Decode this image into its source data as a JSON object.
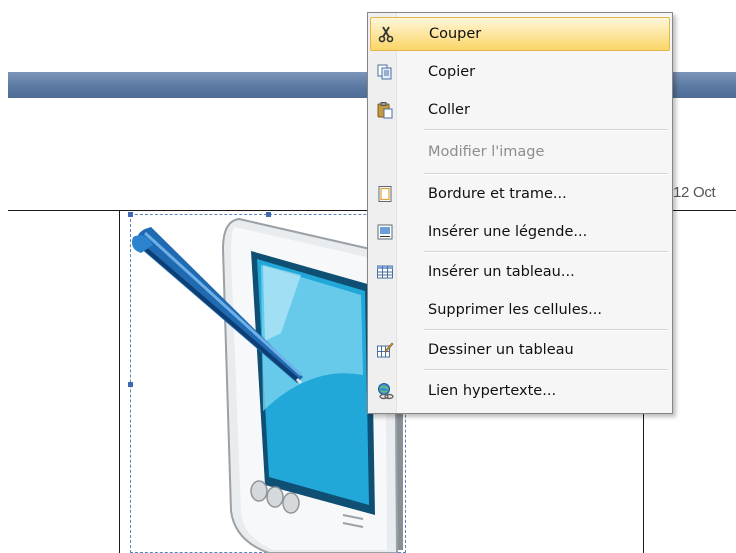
{
  "document": {
    "date_fragment": "12 Oct"
  },
  "context_menu": {
    "items": [
      {
        "label": "Couper",
        "icon": "scissors-icon",
        "highlighted": true,
        "enabled": true
      },
      {
        "label": "Copier",
        "icon": "copy-icon",
        "enabled": true
      },
      {
        "label": "Coller",
        "icon": "paste-icon",
        "enabled": true
      },
      {
        "label": "Modifier l'image",
        "icon": "",
        "enabled": false
      },
      {
        "label": "Bordure et trame...",
        "icon": "page-border-icon",
        "enabled": true
      },
      {
        "label": "Insérer une légende...",
        "icon": "caption-icon",
        "enabled": true
      },
      {
        "label": "Insérer un tableau...",
        "icon": "table-icon",
        "enabled": true
      },
      {
        "label": "Supprimer les cellules...",
        "icon": "",
        "enabled": true
      },
      {
        "label": "Dessiner un tableau",
        "icon": "draw-table-icon",
        "enabled": true
      },
      {
        "label": "Lien hypertexte...",
        "icon": "hyperlink-icon",
        "enabled": true
      }
    ]
  },
  "colors": {
    "highlight": "#fbd667",
    "title_bar": "#5b7aa3",
    "selection_frame": "#5b82bd"
  }
}
